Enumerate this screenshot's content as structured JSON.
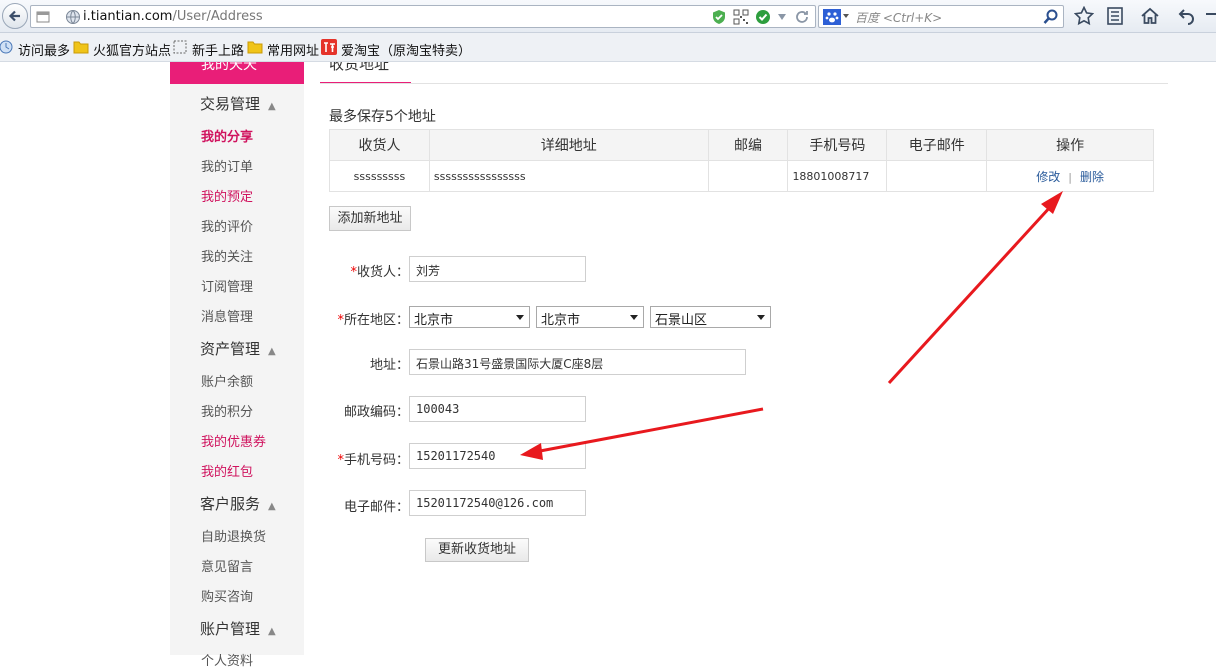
{
  "browser": {
    "url_host": "i.tiantian.com",
    "url_path": "/User/Address",
    "search_placeholder": "百度 <Ctrl+K>",
    "bookmarks": [
      "访问最多",
      "火狐官方站点",
      "新手上路",
      "常用网址",
      "爱淘宝（原淘宝特卖）"
    ]
  },
  "sidebar": {
    "top_label": "我的天天",
    "groups": [
      {
        "title": "交易管理",
        "items": [
          "我的分享",
          "我的订单",
          "我的预定",
          "我的评价",
          "我的关注",
          "订阅管理",
          "消息管理"
        ]
      },
      {
        "title": "资产管理",
        "items": [
          "账户余额",
          "我的积分",
          "我的优惠券",
          "我的红包"
        ]
      },
      {
        "title": "客户服务",
        "items": [
          "自助退换货",
          "意见留言",
          "购买咨询"
        ]
      },
      {
        "title": "账户管理",
        "items": [
          "个人资料"
        ]
      }
    ]
  },
  "main": {
    "title": "收货地址",
    "note": "最多保存5个地址",
    "table": {
      "headers": [
        "收货人",
        "详细地址",
        "邮编",
        "手机号码",
        "电子邮件",
        "操作"
      ],
      "rows": [
        {
          "name": "sssssssss",
          "address": "ssssssssssssssss",
          "zip": "",
          "phone": "18801008717",
          "email": "",
          "edit": "修改",
          "delete": "删除"
        }
      ]
    },
    "add_button": "添加新地址",
    "form": {
      "receiver_label": "收货人：",
      "receiver_value": "刘芳",
      "region_label": "所在地区：",
      "province": "北京市",
      "city": "北京市",
      "district": "石景山区",
      "address_label": "地址：",
      "address_value": "石景山路31号盛景国际大厦C座8层",
      "zip_label": "邮政编码：",
      "zip_value": "100043",
      "phone_label": "手机号码：",
      "phone_value": "15201172540",
      "email_label": "电子邮件：",
      "email_value": "15201172540@126.com",
      "submit": "更新收货地址"
    },
    "required_mark": "*"
  },
  "colors": {
    "accent": "#e91e78",
    "link": "#2a5b9b",
    "annotation_arrow": "#e8191e"
  }
}
